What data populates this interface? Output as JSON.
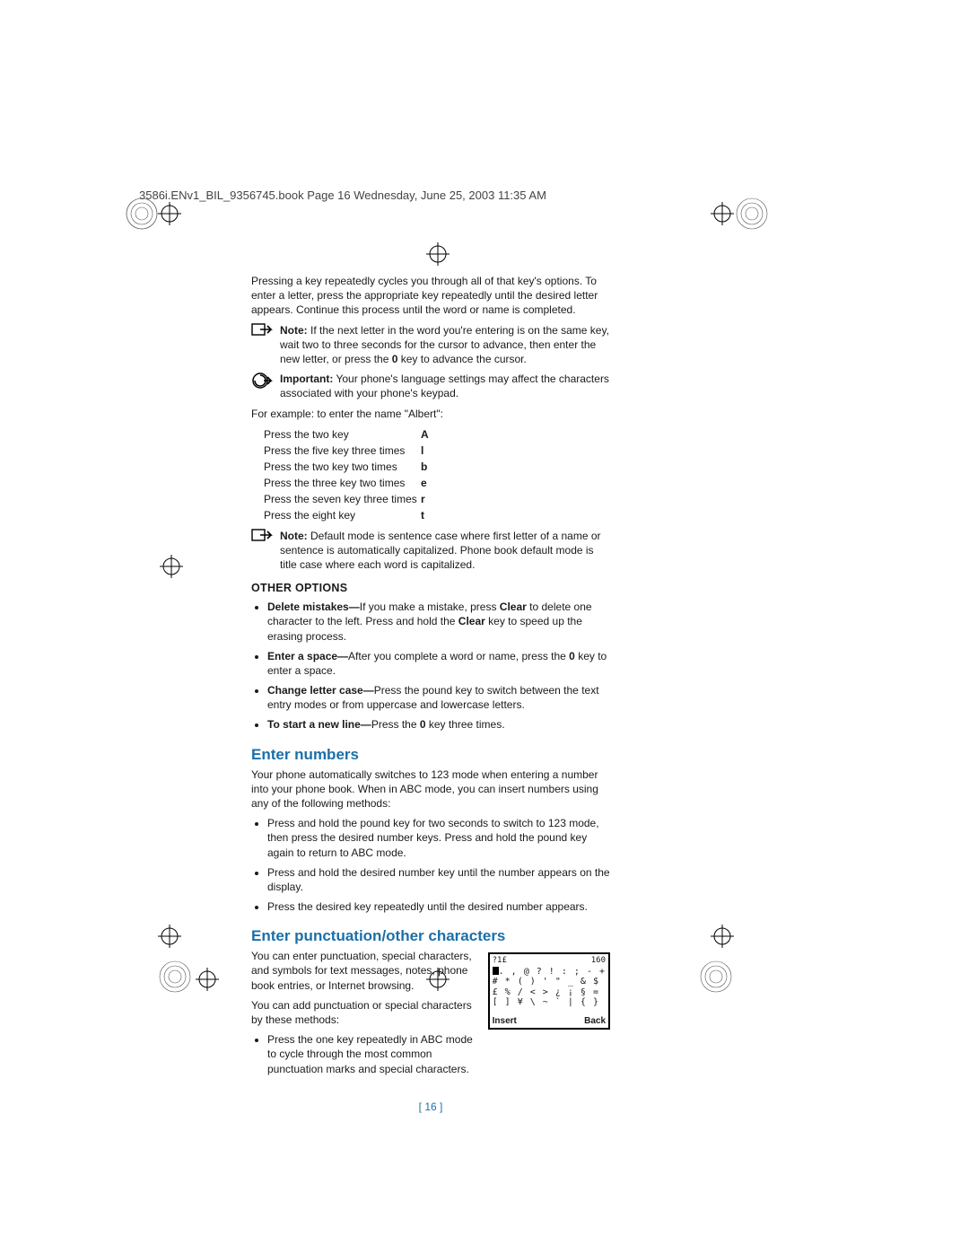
{
  "header": "3586i.ENv1_BIL_9356745.book  Page 16  Wednesday, June 25, 2003  11:35 AM",
  "intro": "Pressing a key repeatedly cycles you through all of that key's options. To enter a letter, press the appropriate key repeatedly until the desired letter appears. Continue this process until the word or name is completed.",
  "note1": {
    "label": "Note:",
    "text": " If the next letter in the word you're entering is on the same key, wait two to three seconds for the cursor to advance, then enter the new letter, or press the ",
    "bold_in": "0",
    "text2": " key to advance the cursor."
  },
  "important": {
    "label": "Important:",
    "text": " Your phone's language settings may affect the characters associated with your phone's keypad."
  },
  "example_intro": "For example: to enter the name \"Albert\":",
  "example_rows": [
    {
      "action": "Press the two key",
      "char": "A"
    },
    {
      "action": "Press the five key three times",
      "char": "l"
    },
    {
      "action": "Press the two key two times",
      "char": "b"
    },
    {
      "action": "Press the three key two times",
      "char": "e"
    },
    {
      "action": "Press the seven key three times",
      "char": "r"
    },
    {
      "action": "Press the eight key",
      "char": "t"
    }
  ],
  "note2": {
    "label": "Note:",
    "text": " Default mode is sentence case where first letter of a name or sentence is automatically capitalized. Phone book default mode is title case where each word is capitalized."
  },
  "other_options": {
    "heading": "OTHER OPTIONS",
    "items": [
      {
        "bold": "Delete mistakes—",
        "text": "If you make a mistake, press ",
        "bold2": "Clear",
        "text2": " to delete one character to the left. Press and hold the ",
        "bold3": "Clear",
        "text3": " key to speed up the erasing process."
      },
      {
        "bold": "Enter a space—",
        "text": "After you complete a word or name, press the ",
        "bold2": "0",
        "text2": " key to enter a space."
      },
      {
        "bold": "Change letter case—",
        "text": "Press the pound key to switch between the text entry modes or from uppercase and lowercase letters."
      },
      {
        "bold": "To start a new line—",
        "text": "Press the ",
        "bold2": "0",
        "text2": " key three times."
      }
    ]
  },
  "enter_numbers": {
    "heading": "Enter numbers",
    "intro": "Your phone automatically switches to 123 mode when entering a number into your phone book. When in ABC mode, you can insert numbers using any of the following methods:",
    "items": [
      "Press and hold the pound key for two seconds to switch to 123 mode, then press the desired number keys. Press and hold the pound key again to return to ABC mode.",
      "Press and hold the desired number key until the number appears on the display.",
      "Press the desired key repeatedly until the desired number appears."
    ]
  },
  "enter_punct": {
    "heading": "Enter punctuation/other characters",
    "p1": "You can enter punctuation, special characters, and symbols for text messages, notes, phone book entries, or Internet browsing.",
    "p2": "You can add punctuation or special characters by these methods:",
    "items": [
      "Press the one key repeatedly in ABC mode to cycle through the most common punctuation marks and special characters."
    ],
    "screen": {
      "top_left": "?1£",
      "top_right": "160",
      "row1": ". , @ ? ! : ; - +",
      "row2": "# * ( ) ' \" _ & $",
      "row3": "£ % / < > ¿ ¡ § =",
      "row4": "[ ] ¥ \\ ~ ` | { }",
      "insert": "Insert",
      "back": "Back"
    }
  },
  "page_number": "[ 16 ]"
}
